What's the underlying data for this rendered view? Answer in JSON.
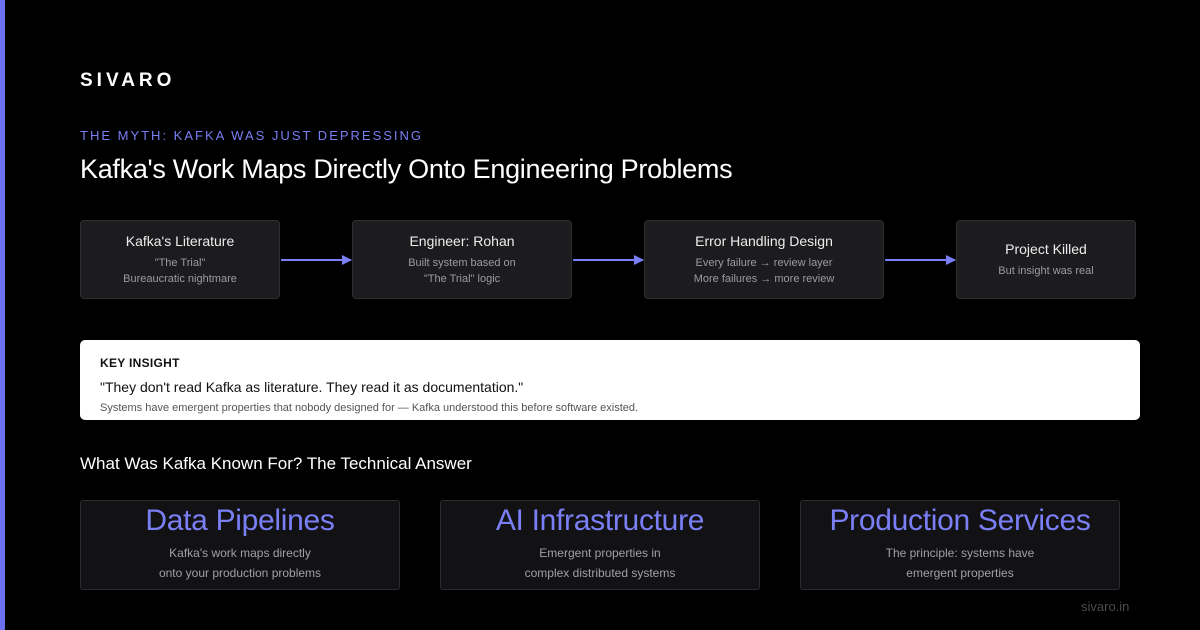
{
  "brand": "SIVARO",
  "eyebrow": "THE MYTH: KAFKA WAS JUST DEPRESSING",
  "headline": "Kafka's Work Maps Directly Onto Engineering Problems",
  "flow": [
    {
      "title": "Kafka's Literature",
      "lines": [
        "\"The Trial\"",
        "Bureaucratic nightmare"
      ]
    },
    {
      "title": "Engineer: Rohan",
      "lines": [
        "Built system based on",
        "\"The Trial\" logic"
      ]
    },
    {
      "title": "Error Handling Design",
      "lines": [
        "Every failure → review layer",
        "More failures → more review"
      ]
    },
    {
      "title": "Project Killed",
      "lines": [
        "But insight was real"
      ]
    }
  ],
  "insight": {
    "label": "KEY INSIGHT",
    "quote": "\"They don't read Kafka as literature. They read it as documentation.\"",
    "note": "Systems have emergent properties that nobody designed for — Kafka understood this before software existed."
  },
  "section_title": "What Was Kafka Known For? The Technical Answer",
  "cards": [
    {
      "title": "Data Pipelines",
      "lines": [
        "Kafka's work maps directly",
        "onto your production problems"
      ]
    },
    {
      "title": "AI Infrastructure",
      "lines": [
        "Emergent properties in",
        "complex distributed systems"
      ]
    },
    {
      "title": "Production Services",
      "lines": [
        "The principle: systems have",
        "emergent properties"
      ]
    }
  ],
  "footer": "sivaro.in",
  "colors": {
    "accent": "#7b7ff5",
    "background": "#000000",
    "box": "#1c1c1f"
  }
}
